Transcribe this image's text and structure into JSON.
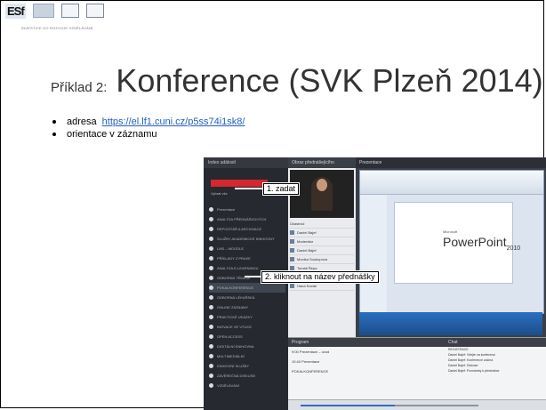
{
  "header": {
    "logo_text": "ESf",
    "logo_caption": "INVESTICE DO ROZVOJE VZDĚLÁVÁNÍ"
  },
  "slide": {
    "title_prefix": "Příklad 2:",
    "title": "Konference (SVK Plzeň 2014)",
    "bullets": [
      {
        "label": "adresa ",
        "link": "https://el.lf1.cuni.cz/p5ss74i1sk8/"
      },
      {
        "label": "orientace v záznamu"
      }
    ]
  },
  "screenshot": {
    "left_panel": {
      "header": "Index událostí",
      "filter_label": "Vybrat vše",
      "presentation_header": "Prezentace",
      "items": [
        "ANALÝZA PŘEDNÁŠKOVÝCH",
        "REPOZITÁŘ A ARCHIVACE",
        "SLUŽBY AKADEMICKÉ KNIHOVNY",
        "LMS – MOODLE",
        "PŘÍKLADY Z PRAXE",
        "ANALÝZA E-LEARNINGU",
        "ODBORNÁ TÉMATA",
        "POKALKONFERENCE",
        "ODBORNÁ LÉKAŘSKÁ",
        "ONLINE ZÁZNAMY",
        "PRAKTICKÉ UKÁZKY",
        "INOVACE VE VÝUCE",
        "OPEN ACCESS",
        "DIGITÁLNÍ KNIHOVNA",
        "MULTIMEDIÁLNÍ",
        "KNIHOVNÍ SLUŽBY",
        "ZÁVĚREČNÁ DISKUSE",
        "VZDĚLÁVÁNÍ"
      ]
    },
    "mid_panel": {
      "header": "Obraz přednášejícího",
      "speaker_label": "Daniel Bajer",
      "participants_header": "Účastníci",
      "participants": [
        "Daniel Bajeř",
        "Moderátor",
        "Daniel Bajeř",
        "Monika Soukupová",
        "Tomáš Řepa",
        "Irena Nováková",
        "Hana Novák"
      ]
    },
    "right_panel": {
      "header": "Prezentace",
      "ppt_brand": "Microsoft",
      "ppt_title": "PowerPoint",
      "ppt_version": "2010"
    },
    "program": {
      "header": "Program",
      "rows": [
        "9:00 Prezentace – úvod",
        "10:40 Prezentace",
        "POKALKONFERENCE"
      ]
    },
    "chat": {
      "header": "Chat",
      "messages": [
        "REGISTRACE",
        "Daniel Bajeř: Vítejte na konferenci",
        "Daniel Bajeř: Konference začíná",
        "Daniel Bajeř: Diskuse",
        "Daniel Bajeř: Poznámky k přednášce"
      ]
    },
    "player": {
      "progress": 0.53
    },
    "callouts": [
      "1. zadat",
      "2. kliknout na název přednášky"
    ]
  }
}
